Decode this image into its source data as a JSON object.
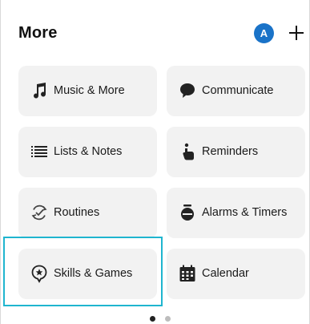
{
  "header": {
    "title": "More",
    "avatar_letter": "A"
  },
  "tiles": [
    {
      "label": "Music & More",
      "icon": "music-note-icon"
    },
    {
      "label": "Communicate",
      "icon": "chat-bubble-icon"
    },
    {
      "label": "Lists & Notes",
      "icon": "list-icon"
    },
    {
      "label": "Reminders",
      "icon": "reminder-hand-icon"
    },
    {
      "label": "Routines",
      "icon": "routine-check-icon"
    },
    {
      "label": "Alarms & Timers",
      "icon": "alarm-clock-icon"
    },
    {
      "label": "Skills & Games",
      "icon": "skills-star-icon"
    },
    {
      "label": "Calendar",
      "icon": "calendar-icon"
    }
  ],
  "pagination": {
    "pages": 2,
    "current": 1
  },
  "colors": {
    "accent": "#1a73c8",
    "highlight": "#1fb5cf",
    "tile_bg": "#f2f2f2"
  }
}
